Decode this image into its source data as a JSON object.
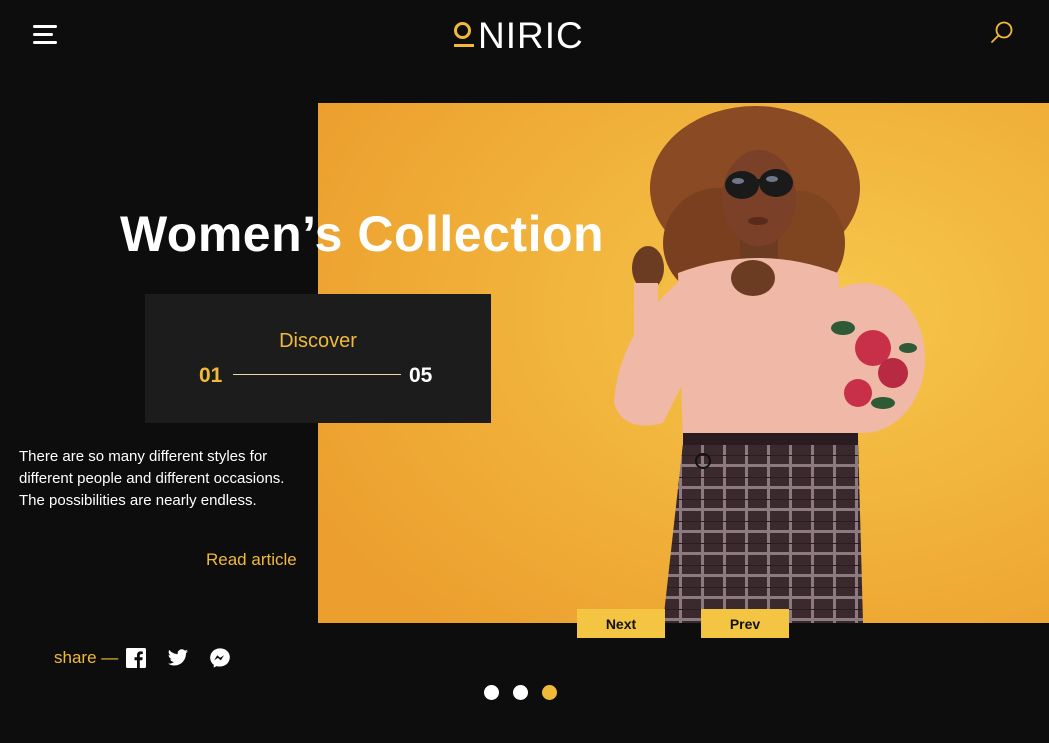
{
  "header": {
    "logo_text": "NIRIC",
    "brand_color": "#f0b93a",
    "menu_icon": "hamburger-menu-icon",
    "search_icon": "search-icon"
  },
  "hero": {
    "title": "Women’s Collection",
    "image_description_icon": "model-photo",
    "discover": {
      "label": "Discover",
      "current": "01",
      "total": "05"
    },
    "description": "There are so many different styles for different people and different occasions. The possibilities are nearly endless.",
    "read_article": "Read article",
    "next_label": "Next",
    "prev_label": "Prev"
  },
  "share": {
    "label": "share —",
    "icons": [
      "facebook-icon",
      "twitter-icon",
      "messenger-icon"
    ]
  },
  "carousel": {
    "dots": 3,
    "active_index": 2,
    "active_color": "#f0b93a",
    "inactive_color": "#ffffff"
  }
}
